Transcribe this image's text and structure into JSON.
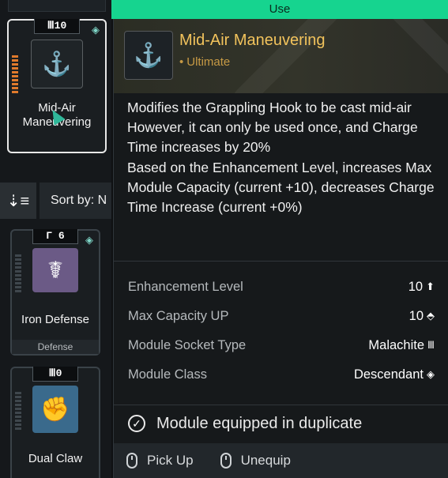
{
  "top_bar": {
    "use_label": "Use"
  },
  "left_cards": [
    {
      "socket_count": "10",
      "name": "Mid-Air\nManeuvering",
      "selected": true,
      "chip_color": "#1f2427"
    },
    {
      "socket_count": "6",
      "name": "Iron Defense",
      "tag": "Defense",
      "chip_color": "#6b5a86"
    },
    {
      "socket_count": "0",
      "name": "Dual Claw",
      "chip_color": "#3a6a8c"
    }
  ],
  "sort": {
    "label": "Sort by: N"
  },
  "tooltip": {
    "title": "Mid-Air Maneuvering",
    "subtitle": "Ultimate",
    "description": [
      "Modifies the Grappling Hook to be cast mid-air",
      "However, it can only be used once, and Charge Time increases by 20%",
      "Based on the Enhancement Level, increases Max Module Capacity (current +10), decreases Charge Time Increase (current +0%)"
    ],
    "stats": [
      {
        "label": "Enhancement Level",
        "value": "10",
        "icon": "enhance-arrow-icon"
      },
      {
        "label": "Max Capacity UP",
        "value": "10",
        "icon": "capacity-icon"
      },
      {
        "label": "Module Socket Type",
        "value": "Malachite",
        "icon": "malachite-socket-icon"
      },
      {
        "label": "Module Class",
        "value": "Descendant",
        "icon": "descendant-class-icon"
      }
    ],
    "duplicate_notice": "Module equipped in duplicate",
    "actions": [
      {
        "label": "Pick Up",
        "icon": "mouse-left-icon"
      },
      {
        "label": "Unequip",
        "icon": "mouse-right-icon"
      }
    ]
  },
  "colors": {
    "accent_green": "#16d48f",
    "title_gold": "#f2c35c",
    "subtitle_gold": "#c79a45"
  }
}
